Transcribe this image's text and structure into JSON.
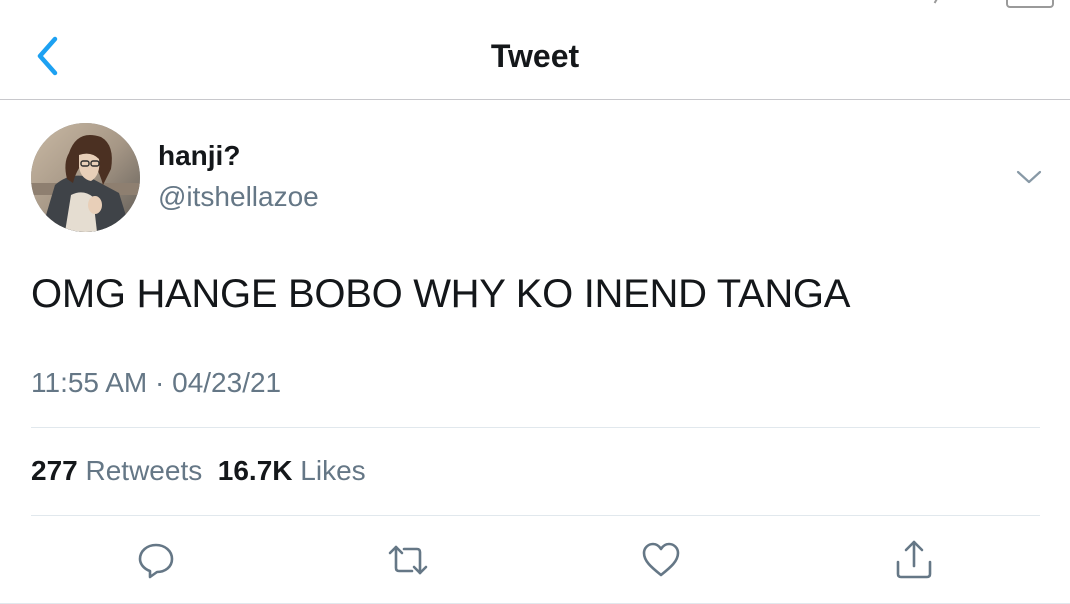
{
  "header": {
    "title": "Tweet",
    "back_icon": "chevron-left-icon"
  },
  "tweet": {
    "author": {
      "display_name": "hanji?",
      "handle": "@itshellazoe"
    },
    "text": "OMG HANGE BOBO WHY KO INEND TANGA",
    "time": "11:55 AM",
    "separator": "·",
    "date": "04/23/21",
    "stats": {
      "retweets_count": "277",
      "retweets_label": "Retweets",
      "likes_count": "16.7K",
      "likes_label": "Likes"
    }
  },
  "actions": [
    {
      "icon": "reply-icon"
    },
    {
      "icon": "retweet-icon"
    },
    {
      "icon": "like-icon"
    },
    {
      "icon": "share-icon"
    }
  ],
  "colors": {
    "accent": "#1da1f2",
    "secondary_text": "#657786",
    "primary_text": "#14171a",
    "divider": "#e1e8ed"
  }
}
